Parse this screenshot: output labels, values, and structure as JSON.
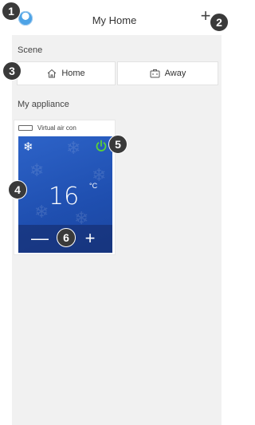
{
  "header": {
    "title": "My Home",
    "add_icon": "plus-icon",
    "add_glyph": "+",
    "avatar_icon": "user-avatar-icon"
  },
  "scene": {
    "label": "Scene",
    "buttons": [
      {
        "label": "Home",
        "icon": "house-icon"
      },
      {
        "label": "Away",
        "icon": "suitcase-icon"
      }
    ]
  },
  "appliances": {
    "label": "My appliance",
    "items": [
      {
        "name": "Virtual air con",
        "mode_icon": "snowflake-icon",
        "power_icon": "power-icon",
        "temperature": "16",
        "unit": "°C",
        "minus_glyph": "—",
        "plus_glyph": "+",
        "power_color": "#5bd137",
        "tile_color": "#2354b8"
      }
    ]
  },
  "callouts": [
    "1",
    "2",
    "3",
    "4",
    "5",
    "6"
  ]
}
